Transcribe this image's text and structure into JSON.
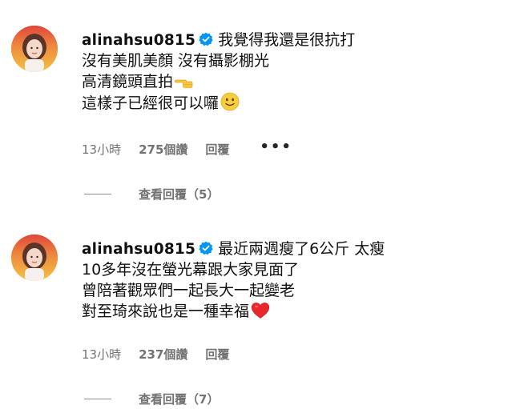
{
  "comments": [
    {
      "username": "alinahsu0815",
      "lines": [
        "我覺得我還是很抗打",
        "沒有美肌美顏 沒有攝影棚光",
        "高清鏡頭直拍",
        "這樣子已經很可以囉"
      ],
      "emojis": [
        "backhand-index-pointing-left-icon",
        "slightly-smiling-face-icon"
      ],
      "time": "13小時",
      "likes": "275個讚",
      "reply_label": "回覆",
      "more_label": "•••",
      "view_replies": "查看回覆（5）"
    },
    {
      "username": "alinahsu0815",
      "lines": [
        "最近兩週瘦了6公斤 太瘦",
        "10多年沒在螢光幕跟大家見面了",
        "曾陪著觀眾們一起長大一起變老",
        "對至琦來說也是一種幸福"
      ],
      "emojis": [
        "red-heart-icon"
      ],
      "time": "13小時",
      "likes": "237個讚",
      "reply_label": "回覆",
      "view_replies": "查看回覆（7）"
    }
  ],
  "colors": {
    "verified": "#0095f6",
    "meta_text": "#737373",
    "body_text": "#111111"
  }
}
